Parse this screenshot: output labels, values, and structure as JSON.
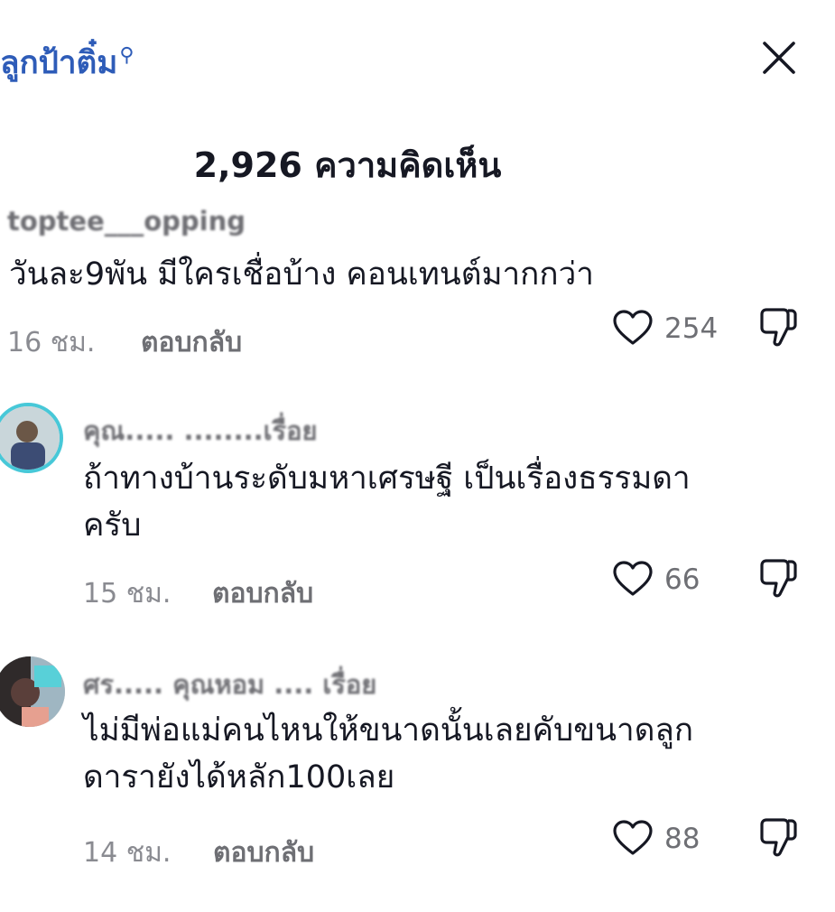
{
  "header": {
    "search_text": "ลูกป้าติ๋ม",
    "search_glyph": "⚲",
    "title": "2,926 ความคิดเห็น"
  },
  "icons": {
    "close": "close-icon",
    "like": "heart-outline-icon",
    "dislike": "thumbs-down-icon",
    "search": "search-icon"
  },
  "comments": [
    {
      "username": "toptee___opping",
      "text_lines": [
        "วันละ9พัน มีใครเชื่อบ้าง คอนเทนต์มากกว่า"
      ],
      "time": "16 ชม.",
      "reply_label": "ตอบกลับ",
      "likes": "254"
    },
    {
      "username": "คุณ..... ........เรื่อย",
      "text_lines": [
        "ถ้าทางบ้านระดับมหาเศรษฐี เป็นเรื่องธรรมดา",
        "ครับ"
      ],
      "time": "15 ชม.",
      "reply_label": "ตอบกลับ",
      "likes": "66"
    },
    {
      "username": "ศร..... คุณหอม .... เรื่อย",
      "text_lines": [
        "ไม่มีพ่อแม่คนไหนให้ขนาดนั้นเลยคับขนาดลูก",
        "ดารายังได้หลัก100เลย"
      ],
      "time": "14 ชม.",
      "reply_label": "ตอบกลับ",
      "likes": "88"
    }
  ],
  "colors": {
    "link": "#2e5cb8",
    "text": "#161823",
    "muted": "#8a8b91",
    "secondary": "#6e6f74"
  }
}
